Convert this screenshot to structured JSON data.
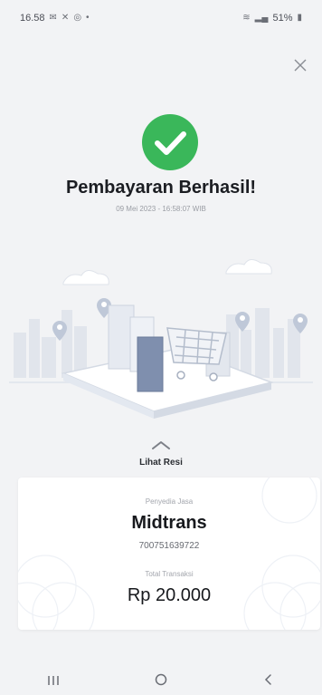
{
  "status_bar": {
    "time": "16.58",
    "battery": "51%"
  },
  "main": {
    "title": "Pembayaran Berhasil!",
    "datetime": "09 Mei 2023 - 16:58:07 WIB",
    "receipt_link": "Lihat Resi"
  },
  "card": {
    "provider_label": "Penyedia Jasa",
    "provider_name": "Midtrans",
    "reference": "700751639722",
    "total_label": "Total Transaksi",
    "amount": "Rp 20.000"
  },
  "colors": {
    "success": "#3ab75a",
    "background": "#f2f3f5",
    "illustration": "#d9dee8"
  },
  "icons": {
    "close": "close-icon",
    "success": "checkmark-circle-icon",
    "expand": "chevron-up-icon",
    "nav": [
      "recent-apps-icon",
      "home-icon",
      "back-icon"
    ]
  }
}
